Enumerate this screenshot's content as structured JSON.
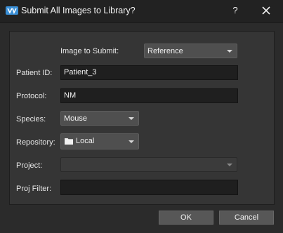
{
  "window": {
    "title": "Submit All Images to Library?",
    "help_label": "?"
  },
  "form": {
    "image_to_submit": {
      "label": "Image to Submit:",
      "value": "Reference"
    },
    "patient_id": {
      "label": "Patient ID:",
      "value": "Patient_3"
    },
    "protocol": {
      "label": "Protocol:",
      "value": "NM"
    },
    "species": {
      "label": "Species:",
      "value": "Mouse"
    },
    "repository": {
      "label": "Repository:",
      "value": "Local",
      "icon": "folder-icon"
    },
    "project": {
      "label": "Project:",
      "value": ""
    },
    "proj_filter": {
      "label": "Proj Filter:",
      "value": ""
    }
  },
  "buttons": {
    "ok": "OK",
    "cancel": "Cancel"
  },
  "colors": {
    "background": "#2b2b2b",
    "panel": "#353535",
    "field": "#1f1f1f",
    "accent_icon": "#3a8fd6"
  }
}
